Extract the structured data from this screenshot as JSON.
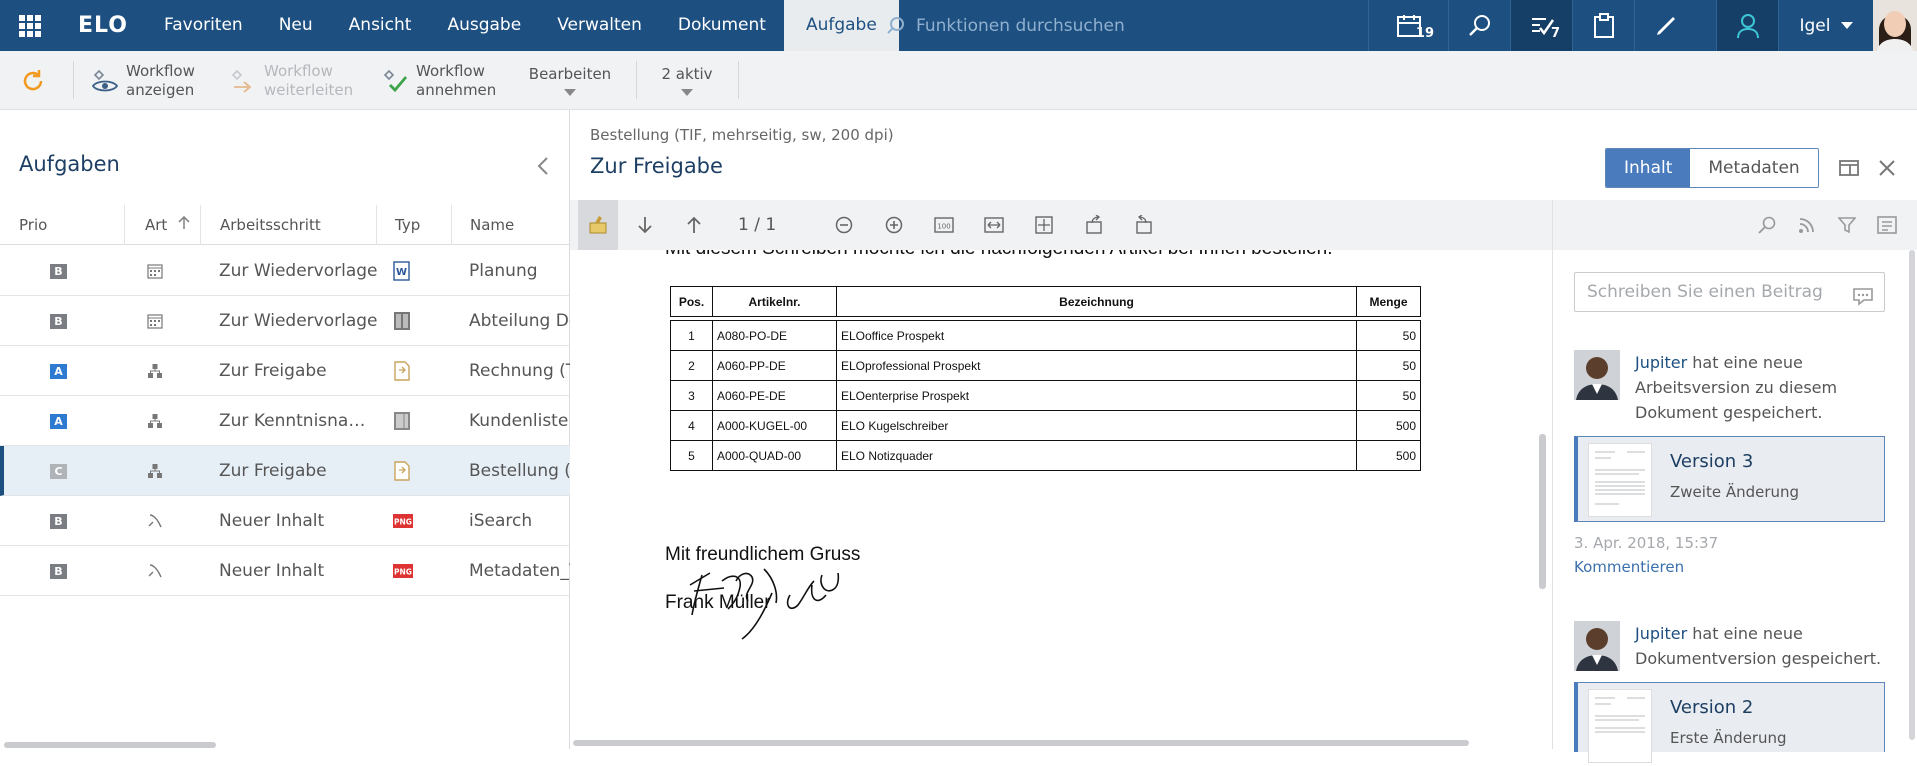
{
  "topbar": {
    "logo": "ELO",
    "menu": [
      "Favoriten",
      "Neu",
      "Ansicht",
      "Ausgabe",
      "Verwalten",
      "Dokument",
      "Aufgabe"
    ],
    "active_menu": "Aufgabe",
    "search_placeholder": "Funktionen durchsuchen",
    "calendar_count": "19",
    "tasks_count": "7",
    "user_name": "Igel"
  },
  "toolbar": {
    "refresh": "refresh-icon",
    "workflow_show": "Workflow anzeigen",
    "workflow_forward": "Workflow weiterleiten",
    "workflow_accept": "Workflow annehmen",
    "edit": "Bearbeiten",
    "active": "2 aktiv"
  },
  "tasks": {
    "title": "Aufgaben",
    "columns": {
      "prio": "Prio",
      "art": "Art",
      "step": "Arbeitsschritt",
      "type": "Typ",
      "name": "Name"
    },
    "rows": [
      {
        "prio": "B",
        "prio_color": "#7a7d82",
        "step": "Zur Wiedervorlage",
        "name": "Planung",
        "type": "word"
      },
      {
        "prio": "B",
        "prio_color": "#7a7d82",
        "step": "Zur Wiedervorlage",
        "name": "Abteilung Do",
        "type": "folder"
      },
      {
        "prio": "A",
        "prio_color": "#2f7ad1",
        "step": "Zur Freigabe",
        "name": "Rechnung (TI",
        "type": "doc"
      },
      {
        "prio": "A",
        "prio_color": "#2f7ad1",
        "step": "Zur Kenntnisna…",
        "name": "Kundenliste",
        "type": "sheet"
      },
      {
        "prio": "C",
        "prio_color": "#b0b3b7",
        "step": "Zur Freigabe",
        "name": "Bestellung (T",
        "type": "doc"
      },
      {
        "prio": "B",
        "prio_color": "#7a7d82",
        "step": "Neuer Inhalt",
        "name": "iSearch",
        "type": "png"
      },
      {
        "prio": "B",
        "prio_color": "#7a7d82",
        "step": "Neuer Inhalt",
        "name": "Metadaten_V",
        "type": "png"
      }
    ]
  },
  "document": {
    "subtitle": "Bestellung (TIF, mehrseitig, sw, 200 dpi)",
    "title": "Zur Freigabe",
    "tab_content": "Inhalt",
    "tab_meta": "Metadaten",
    "page_counter": "1 / 1",
    "cut_line": "Mit diesem Schreiben möchte ich die nachfolgenden Artikel bei Ihnen bestellen:",
    "table_header": [
      "Pos.",
      "Artikelnr.",
      "Bezeichnung",
      "Menge"
    ],
    "table_rows": [
      [
        "1",
        "A080-PO-DE",
        "ELOoffice Prospekt",
        "50"
      ],
      [
        "2",
        "A060-PP-DE",
        "ELOprofessional Prospekt",
        "50"
      ],
      [
        "3",
        "A060-PE-DE",
        "ELOenterprise Prospekt",
        "50"
      ],
      [
        "4",
        "A000-KUGEL-00",
        "ELO Kugelschreiber",
        "500"
      ],
      [
        "5",
        "A000-QUAD-00",
        "ELO Notizquader",
        "500"
      ]
    ],
    "greeting": "Mit freundlichem Gruss",
    "signature_name": "Frank Müller"
  },
  "feed": {
    "comment_placeholder": "Schreiben Sie einen Beitrag",
    "entries": [
      {
        "user": "Jupiter",
        "text": " hat eine neue Arbeitsversion zu diesem Dokument gespeichert.",
        "version": "Version 3",
        "change": "Zweite Änderung",
        "date": "3. Apr. 2018, 15:37",
        "comment_link": "Kommentieren"
      },
      {
        "user": "Jupiter",
        "text": " hat eine neue Dokumentversion gespeichert.",
        "version": "Version 2",
        "change": "Erste Änderung"
      }
    ]
  }
}
